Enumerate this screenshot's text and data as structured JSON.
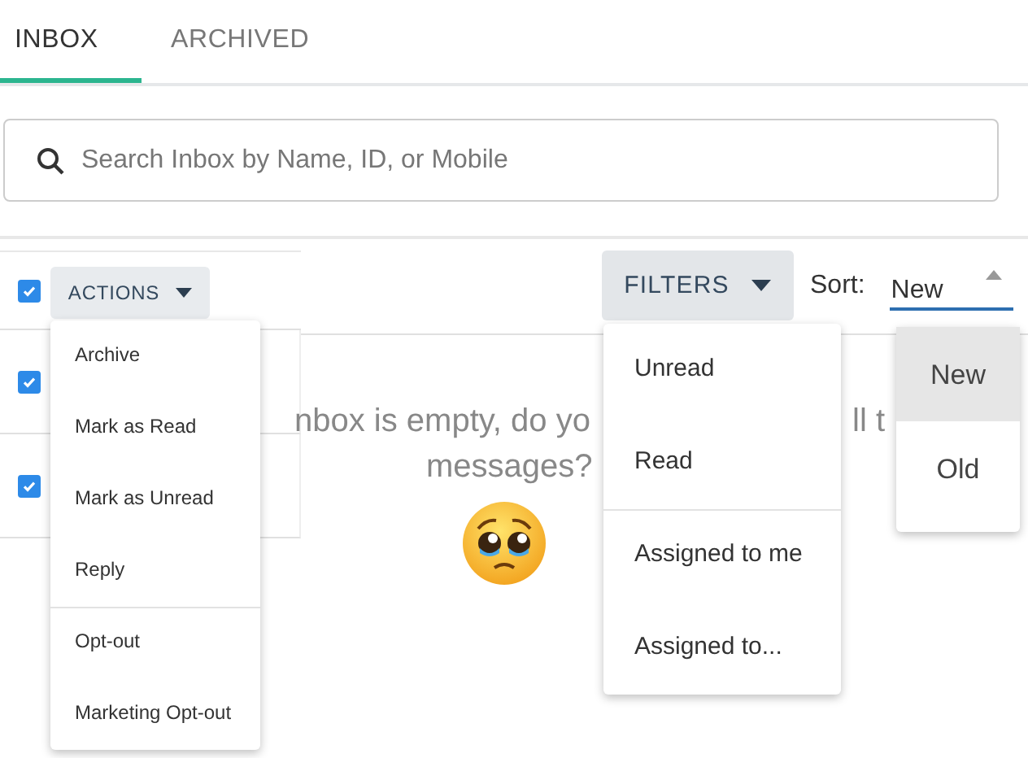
{
  "tabs": [
    {
      "label": "INBOX",
      "selected": true
    },
    {
      "label": "ARCHIVED",
      "selected": false
    }
  ],
  "search": {
    "placeholder": "Search Inbox by Name, ID, or Mobile"
  },
  "toolbar": {
    "select_all": {
      "checked": true
    },
    "actions_button": "ACTIONS",
    "filters_button": "FILTERS",
    "sort": {
      "label": "Sort:",
      "value": "New",
      "open": true
    }
  },
  "rows": [
    {
      "checked": true
    },
    {
      "checked": true
    }
  ],
  "empty_message": {
    "line_1_left": "nbox is empty, do yo",
    "line_1_right": "ll t",
    "line_2": "messages?"
  },
  "actions_menu": [
    {
      "label": "Archive",
      "divider_before": false
    },
    {
      "label": "Mark as Read",
      "divider_before": false
    },
    {
      "label": "Mark as Unread",
      "divider_before": false
    },
    {
      "label": "Reply",
      "divider_before": false
    },
    {
      "label": "Opt-out",
      "divider_before": true
    },
    {
      "label": "Marketing Opt-out",
      "divider_before": false
    }
  ],
  "filters_menu": [
    {
      "label": "Unread",
      "divider_before": false
    },
    {
      "label": "Read",
      "divider_before": false
    },
    {
      "label": "Assigned to me",
      "divider_before": true
    },
    {
      "label": "Assigned to...",
      "divider_before": false
    }
  ],
  "sort_menu": [
    {
      "label": "New",
      "selected": true
    },
    {
      "label": "Old",
      "selected": false
    }
  ]
}
